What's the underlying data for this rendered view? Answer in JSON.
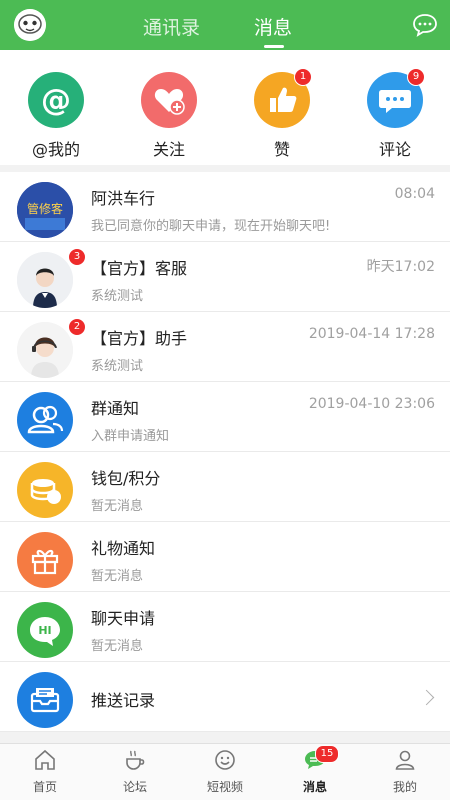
{
  "header": {
    "tabs": [
      {
        "label": "通讯录",
        "active": false
      },
      {
        "label": "消息",
        "active": true
      }
    ]
  },
  "quick": [
    {
      "label": "@我的",
      "icon": "at-icon",
      "color": "#26b079",
      "badge": ""
    },
    {
      "label": "关注",
      "icon": "heart-plus-icon",
      "color": "#f26b6b",
      "badge": ""
    },
    {
      "label": "赞",
      "icon": "thumbs-up-icon",
      "color": "#f5a623",
      "badge": "1"
    },
    {
      "label": "评论",
      "icon": "comment-icon",
      "color": "#2f9bea",
      "badge": "9"
    }
  ],
  "rows": [
    {
      "title": "阿洪车行",
      "sub": "我已同意你的聊天申请，现在开始聊天吧!",
      "time": "08:04",
      "badge": "",
      "avatar_text": "管修客"
    },
    {
      "title": "【官方】客服",
      "sub": "系统测试",
      "time": "昨天17:02",
      "badge": "3"
    },
    {
      "title": "【官方】助手",
      "sub": "系统测试",
      "time": "2019-04-14 17:28",
      "badge": "2"
    },
    {
      "title": "群通知",
      "sub": "入群申请通知",
      "time": "2019-04-10 23:06",
      "badge": ""
    },
    {
      "title": "钱包/积分",
      "sub": "暂无消息",
      "time": "",
      "badge": ""
    },
    {
      "title": "礼物通知",
      "sub": "暂无消息",
      "time": "",
      "badge": ""
    },
    {
      "title": "聊天申请",
      "sub": "暂无消息",
      "time": "",
      "badge": "",
      "avatar_text": "HI"
    },
    {
      "title": "推送记录",
      "sub": "",
      "time": "",
      "badge": ""
    }
  ],
  "tabbar": [
    {
      "label": "首页",
      "icon": "home-icon"
    },
    {
      "label": "论坛",
      "icon": "coffee-icon"
    },
    {
      "label": "短视频",
      "icon": "smiley-icon"
    },
    {
      "label": "消息",
      "icon": "message-icon",
      "badge": "15",
      "active": true
    },
    {
      "label": "我的",
      "icon": "person-icon"
    }
  ]
}
